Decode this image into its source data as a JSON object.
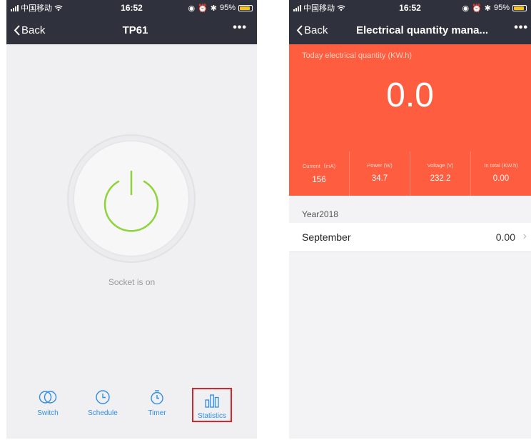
{
  "left": {
    "status": {
      "carrier": "中国移动",
      "time": "16:52",
      "battery": "95%"
    },
    "nav": {
      "back": "Back",
      "title": "TP61"
    },
    "socket_status": "Socket is on",
    "tabs": [
      {
        "label": "Switch",
        "icon": "switch-icon"
      },
      {
        "label": "Schedule",
        "icon": "clock-icon"
      },
      {
        "label": "Timer",
        "icon": "stopwatch-icon"
      },
      {
        "label": "Statistics",
        "icon": "bar-chart-icon"
      }
    ],
    "colors": {
      "power_green": "#8fd33a",
      "tab_blue": "#2f8ee6",
      "highlight": "#d8252b"
    }
  },
  "right": {
    "status": {
      "carrier": "中国移动",
      "time": "16:52",
      "battery": "95%"
    },
    "nav": {
      "back": "Back",
      "title": "Electrical quantity mana..."
    },
    "today_label": "Today electrical quantity (KW.h)",
    "today_value": "0.0",
    "metrics": [
      {
        "label": "Current（mA)",
        "value": "156"
      },
      {
        "label": "Power (W)",
        "value": "34.7"
      },
      {
        "label": "Voltage (V)",
        "value": "232.2"
      },
      {
        "label": "In total (KW.h)",
        "value": "0.00"
      }
    ],
    "year": "Year2018",
    "months": [
      {
        "name": "September",
        "value": "0.00"
      }
    ],
    "colors": {
      "hero": "#ff5d3f"
    }
  }
}
